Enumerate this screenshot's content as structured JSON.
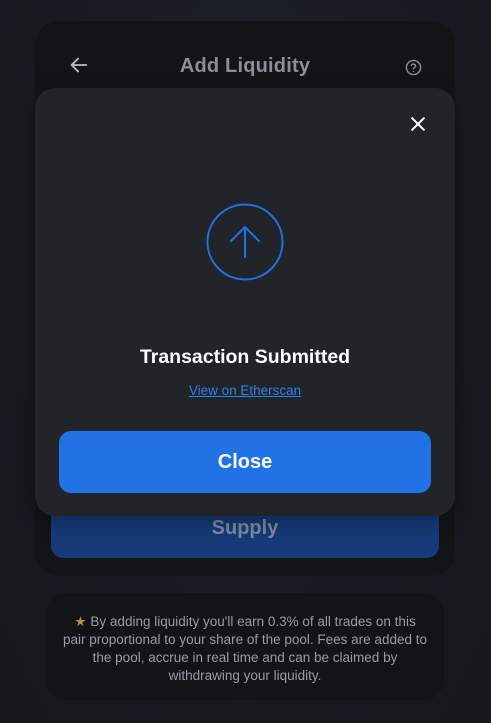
{
  "card": {
    "title": "Add Liquidity",
    "supply_label": "Supply",
    "back_icon": "arrow-left-icon",
    "help_icon": "question-circle-icon"
  },
  "modal": {
    "title": "Transaction Submitted",
    "link_label": "View on Etherscan",
    "close_label": "Close",
    "close_icon": "close-icon",
    "status_icon": "arrow-up-circle-icon"
  },
  "info": {
    "star": "★",
    "text": "By adding liquidity you'll earn 0.3% of all trades on this pair proportional to your share of the pool. Fees are added to the pool, accrue in real time and can be claimed by withdrawing your liquidity."
  },
  "colors": {
    "accent": "#2172e5",
    "link": "#2f80ed",
    "modal_bg": "#212429",
    "card_bg": "#121418",
    "supply_bg": "#163b78",
    "star": "#b78f3b"
  }
}
